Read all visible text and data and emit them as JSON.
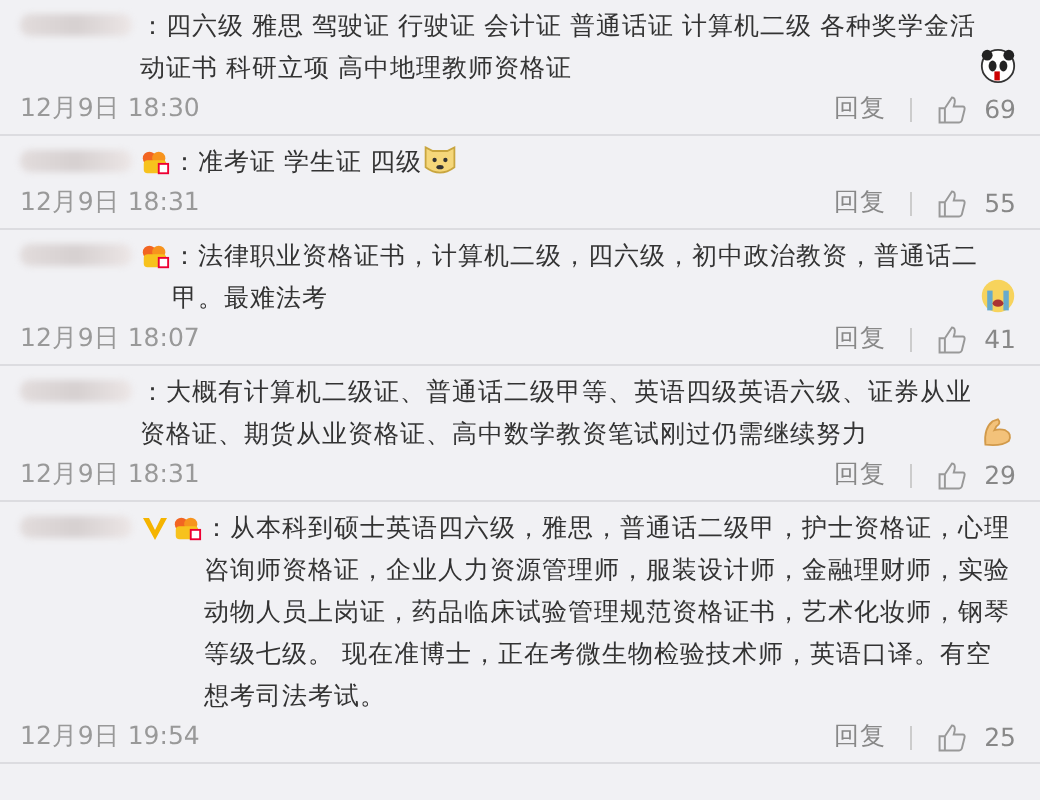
{
  "comments": [
    {
      "verified": false,
      "badge": false,
      "text": "：四六级 雅思 驾驶证 行驶证 会计证 普通话证 计算机二级 各种奖学金活动证书 科研立项 高中地理教师资格证",
      "emoji": {
        "kind": "panda"
      },
      "date": "12月9日 18:30",
      "reply": "回复",
      "likes": "69"
    },
    {
      "verified": false,
      "badge": true,
      "text": "：准考证  学生证  四级",
      "emoji": {
        "kind": "dog"
      },
      "date": "12月9日 18:31",
      "reply": "回复",
      "likes": "55"
    },
    {
      "verified": false,
      "badge": true,
      "text": "：法律职业资格证书，计算机二级，四六级，初中政治教资，普通话二甲。最难法考",
      "emoji": {
        "kind": "crying"
      },
      "date": "12月9日 18:07",
      "reply": "回复",
      "likes": "41"
    },
    {
      "verified": false,
      "badge": false,
      "text": "：大概有计算机二级证、普通话二级甲等、英语四级英语六级、证券从业资格证、期货从业资格证、高中数学教资笔试刚过仍需继续努力",
      "emoji": {
        "kind": "arm"
      },
      "date": "12月9日 18:31",
      "reply": "回复",
      "likes": "29"
    },
    {
      "verified": true,
      "badge": true,
      "text": "：从本科到硕士英语四六级，雅思，普通话二级甲，护士资格证，心理咨询师资格证，企业人力资源管理师，服装设计师，金融理财师，实验动物人员上岗证，药品临床试验管理规范资格证书，艺术化妆师，钢琴等级七级。 现在准博士，正在考微生物检验技术师，英语口译。有空想考司法考试。",
      "date": "12月9日 19:54",
      "reply": "回复",
      "likes": "25"
    }
  ]
}
